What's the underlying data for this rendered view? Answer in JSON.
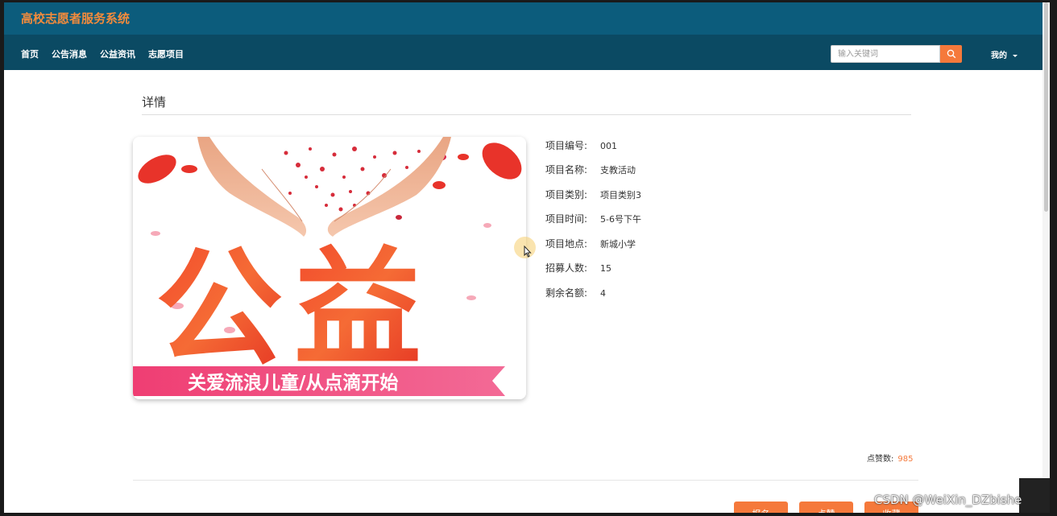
{
  "header": {
    "site_title": "高校志愿者服务系统"
  },
  "nav": {
    "items": [
      "首页",
      "公告消息",
      "公益资讯",
      "志愿项目"
    ],
    "search_placeholder": "输入关键词",
    "my_label": "我的"
  },
  "detail": {
    "section_title": "详情",
    "image": {
      "big_text_1": "公",
      "big_text_2": "益",
      "banner_text": "关爱流浪儿童/从点滴开始"
    },
    "fields": [
      {
        "label": "项目编号:",
        "value": "001"
      },
      {
        "label": "项目名称:",
        "value": "支教活动"
      },
      {
        "label": "项目类别:",
        "value": "项目类别3"
      },
      {
        "label": "项目时间:",
        "value": "5-6号下午"
      },
      {
        "label": "项目地点:",
        "value": "新城小学"
      },
      {
        "label": "招募人数:",
        "value": "15"
      },
      {
        "label": "剩余名额:",
        "value": "4"
      }
    ],
    "likes_label": "点赞数:",
    "likes_count": "985",
    "buttons": [
      "报名",
      "点赞",
      "收藏"
    ]
  },
  "watermark": "CSDN @WeiXin_DZbishe",
  "colors": {
    "topbar": "#0c5c7c",
    "navbar": "#0b4a63",
    "accent": "#f5793b",
    "title": "#f38b3c"
  },
  "icons": {
    "search": "search-icon",
    "dropdown": "chevron-down-icon"
  }
}
